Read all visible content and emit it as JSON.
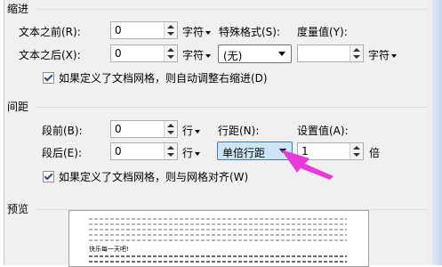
{
  "indent": {
    "title": "缩进",
    "before_label": "文本之前(R):",
    "before_value": "0",
    "before_unit": "字符",
    "after_label": "文本之后(X):",
    "after_value": "0",
    "after_unit": "字符",
    "special_label": "特殊格式(S):",
    "special_value": "(无)",
    "measure_label": "度量值(Y):",
    "measure_value": "",
    "measure_unit": "字符",
    "grid_checkbox_label": "如果定义了文档网格，则自动调整右缩进(D)",
    "grid_checked": true
  },
  "spacing": {
    "title": "间距",
    "before_label": "段前(B):",
    "before_value": "0",
    "before_unit": "行",
    "after_label": "段后(E):",
    "after_value": "0",
    "after_unit": "行",
    "line_spacing_label": "行距(N):",
    "line_spacing_value": "单倍行距",
    "set_value_label": "设置值(A):",
    "set_value": "1",
    "set_value_unit": "倍",
    "grid_checkbox_label": "如果定义了文档网格，则与网格对齐(W)",
    "grid_checked": true
  },
  "preview": {
    "title": "预览",
    "sample_text": "快乐每一天吧!"
  },
  "colors": {
    "arrow": "#e83ad8",
    "selected_combo_bg": "#cde6f7"
  }
}
